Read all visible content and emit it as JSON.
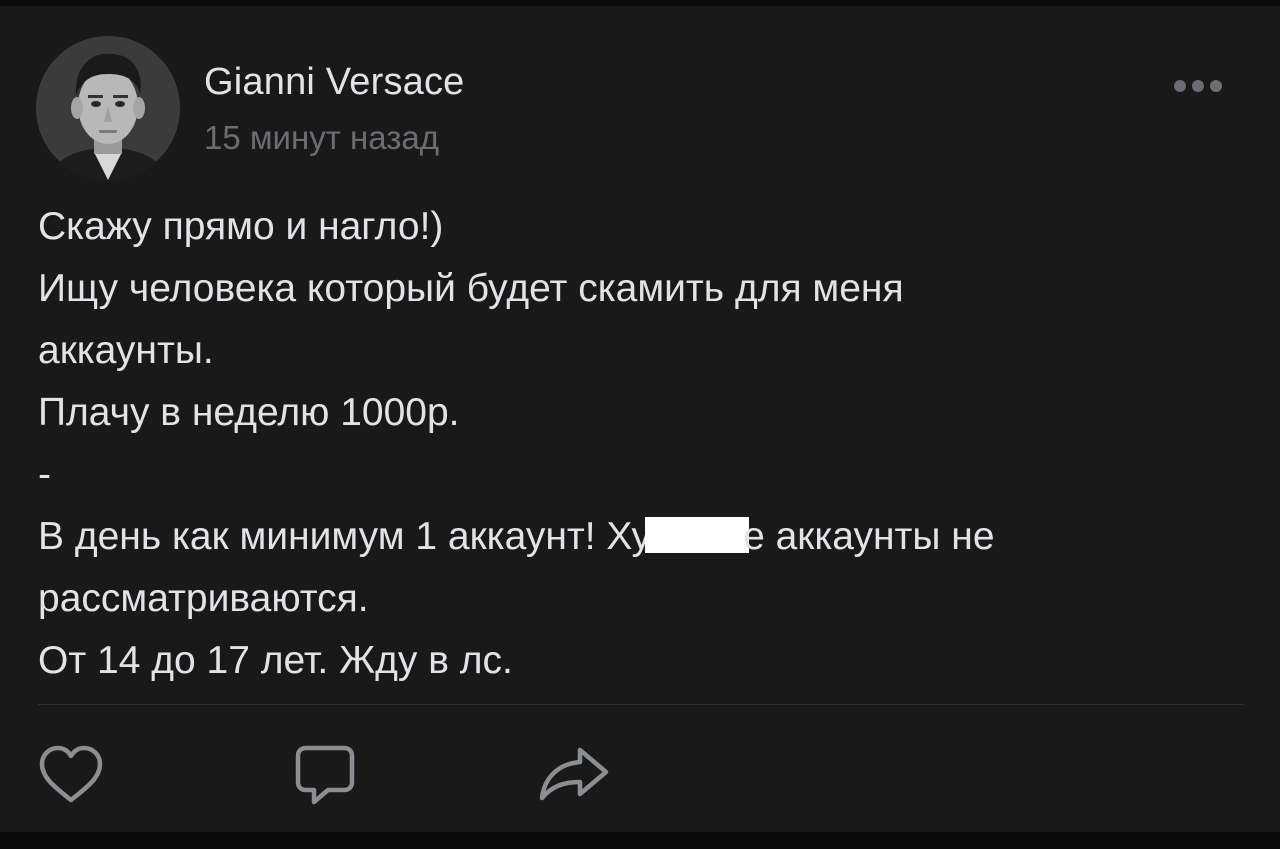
{
  "post": {
    "author": "Gianni Versace",
    "time": "15 минут назад",
    "lines": {
      "l1": "Скажу прямо и нагло!)",
      "l2": "Ищу человека который будет скамить для меня",
      "l3": "аккаунты.",
      "l4": "Плачу в неделю 1000р.",
      "l5": "-",
      "l6a": "В день как минимум 1 аккаунт! Ху",
      "l6b": "е аккаунты не",
      "l7": "рассматриваются.",
      "l8": "От 14 до 17 лет. Жду в лс."
    }
  },
  "icons": {
    "avatar": "avatar-photo",
    "more": "more-horizontal-icon",
    "like": "heart-icon",
    "comment": "comment-icon",
    "share": "share-icon"
  },
  "colors": {
    "background": "#19191a",
    "text": "#e1e3e6",
    "secondary": "#6a6d72",
    "icon": "#8b8e92"
  }
}
